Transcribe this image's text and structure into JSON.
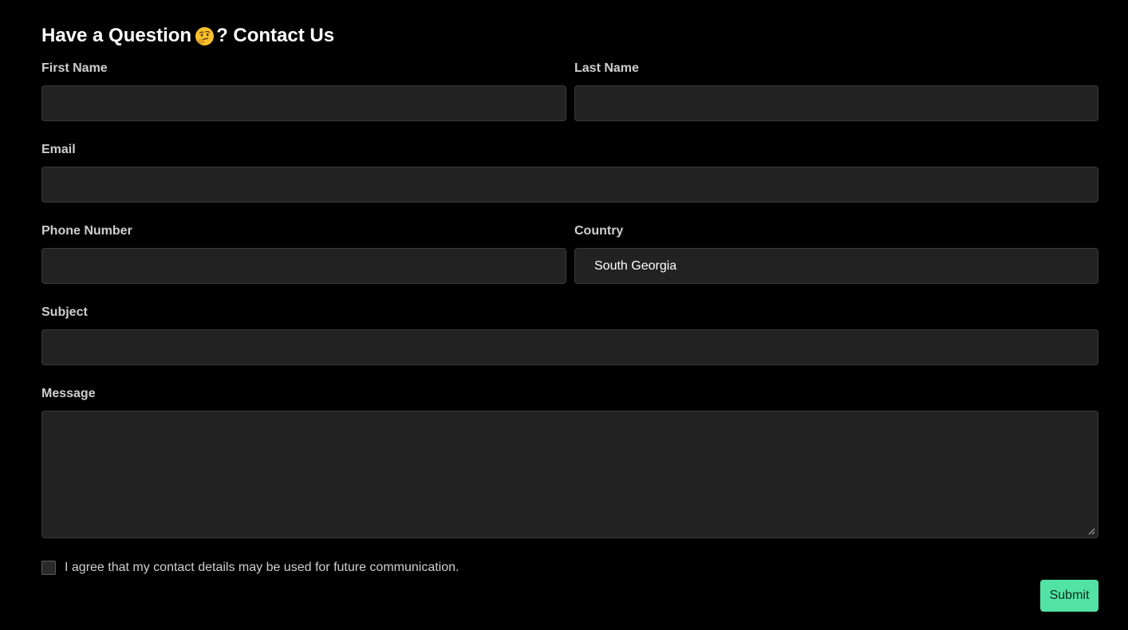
{
  "form": {
    "title_before_emoji": "Have a Question",
    "emoji_icon": "thinking-face-icon",
    "title_after_emoji": "? Contact Us",
    "first_name": {
      "label": "First Name",
      "value": ""
    },
    "last_name": {
      "label": "Last Name",
      "value": ""
    },
    "email": {
      "label": "Email",
      "value": ""
    },
    "phone": {
      "label": "Phone Number",
      "value": ""
    },
    "country": {
      "label": "Country",
      "value": "South Georgia"
    },
    "subject": {
      "label": "Subject",
      "value": ""
    },
    "message": {
      "label": "Message",
      "value": ""
    },
    "consent": {
      "label": "I agree that my contact details may be used for future communication.",
      "checked": false
    },
    "submit_label": "Submit"
  },
  "colors": {
    "background": "#000000",
    "field_background": "#222222",
    "accent": "#52e3a4"
  }
}
